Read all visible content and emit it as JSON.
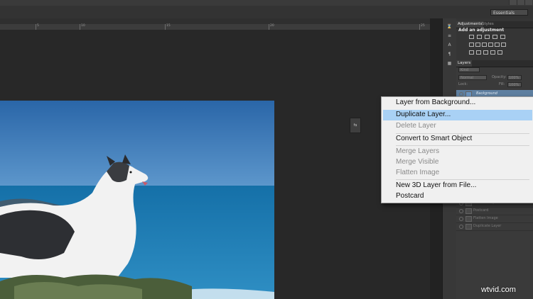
{
  "app": {
    "workspace": "Essentials"
  },
  "ruler": {
    "ticks": [
      "5",
      "10",
      "15",
      "20",
      "25"
    ]
  },
  "panels": {
    "top_tabs": [
      "Adjustments",
      "Styles"
    ],
    "add_adjustment": "Add an adjustment",
    "layers_tab": "Layers",
    "kind": "Kind",
    "blend_mode": "Normal",
    "opacity_label": "Opacity:",
    "opacity_value": "100%",
    "lock_label": "Lock:",
    "fill_label": "Fill:",
    "fill_value": "100%",
    "layer_name": "Background",
    "menu_ghost_items": [
      "New 3D Layer",
      "Postcard",
      "Flatten Image",
      "Duplicate Layer"
    ]
  },
  "context_menu": {
    "items": [
      {
        "label": "Layer from Background...",
        "enabled": true,
        "highlighted": false
      },
      {
        "label": "Duplicate Layer...",
        "enabled": true,
        "highlighted": true
      },
      {
        "label": "Delete Layer",
        "enabled": false,
        "highlighted": false
      },
      {
        "label": "Convert to Smart Object",
        "enabled": true,
        "highlighted": false
      },
      {
        "label": "Merge Layers",
        "enabled": false,
        "highlighted": false
      },
      {
        "label": "Merge Visible",
        "enabled": false,
        "highlighted": false
      },
      {
        "label": "Flatten Image",
        "enabled": false,
        "highlighted": false
      },
      {
        "label": "New 3D Layer from File...",
        "enabled": true,
        "highlighted": false
      },
      {
        "label": "Postcard",
        "enabled": true,
        "highlighted": false
      }
    ]
  },
  "watermark": "wtvid.com",
  "colors": {
    "canvas_bg": "#282828",
    "menu_bg": "#f0f0f0",
    "menu_highlight": "#a9d1f5",
    "sky": "#2f6fb0",
    "sea": "#1a79b3"
  },
  "icons": {
    "tool_strip": [
      "history-icon",
      "properties-icon",
      "character-icon",
      "paragraph-icon",
      "swatch-icon"
    ],
    "floating": "collapsed-panel-icon"
  }
}
